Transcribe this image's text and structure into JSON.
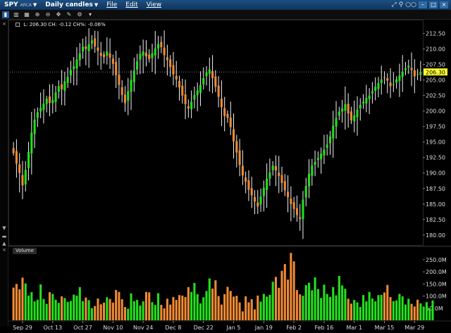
{
  "titlebar": {
    "symbol": "SPY",
    "exchange": "ARCA",
    "chart_type": "Daily candles",
    "menus": [
      "File",
      "Edit",
      "View"
    ]
  },
  "infobar": {
    "text": "L: 206.30 CH: -0.12 CH%: -0.06%"
  },
  "volume_label": "Volume",
  "last_price": "206.30",
  "colors": {
    "up": "#22e01c",
    "down": "#f08a35",
    "background": "#000000",
    "last_tag": "#ffff33"
  },
  "chart_data": [
    {
      "type": "candlestick",
      "price_ticks": [
        "212.50",
        "210.00",
        "207.50",
        "205.00",
        "202.50",
        "200.00",
        "197.50",
        "195.00",
        "192.50",
        "190.00",
        "187.50",
        "185.00",
        "182.50",
        "180.00"
      ],
      "x_tick_labels": [
        "Sep 29",
        "Oct 13",
        "Oct 27",
        "Nov 10",
        "Nov 24",
        "Dec 8",
        "Dec 22",
        "Jan 5",
        "Jan 19",
        "Feb 2",
        "Feb 16",
        "Mar 1",
        "Mar 15",
        "Mar 29"
      ],
      "ylim": [
        178.5,
        214.5
      ],
      "closes": [
        193.2,
        191.5,
        190.0,
        188.0,
        190.5,
        193.4,
        196.5,
        198.6,
        199.8,
        200.5,
        201.2,
        202.0,
        201.3,
        201.8,
        203.0,
        204.0,
        203.5,
        204.8,
        205.5,
        206.6,
        207.2,
        208.3,
        209.3,
        210.4,
        210.0,
        210.8,
        211.4,
        210.4,
        209.7,
        208.9,
        208.7,
        209.6,
        208.6,
        207.6,
        205.8,
        204.2,
        202.6,
        201.3,
        203.2,
        205.0,
        206.5,
        208.0,
        209.2,
        209.6,
        208.8,
        208.4,
        209.3,
        210.1,
        210.8,
        210.3,
        209.0,
        208.2,
        207.1,
        205.9,
        205.1,
        203.8,
        202.5,
        201.1,
        200.4,
        201.5,
        202.6,
        203.3,
        204.2,
        205.3,
        206.2,
        206.7,
        205.3,
        203.9,
        202.3,
        200.6,
        199.2,
        198.9,
        197.4,
        195.1,
        193.3,
        191.3,
        189.6,
        188.6,
        187.3,
        186.4,
        185.4,
        184.6,
        186.2,
        187.6,
        189.1,
        190.1,
        191.2,
        190.4,
        189.5,
        188.4,
        187.2,
        186.1,
        185.0,
        184.2,
        183.2,
        182.6,
        185.7,
        187.9,
        189.9,
        191.2,
        191.8,
        192.4,
        193.1,
        193.8,
        194.6,
        195.9,
        197.6,
        198.9,
        199.9,
        200.4,
        201.1,
        199.6,
        198.5,
        199.3,
        200.2,
        201.0,
        201.5,
        202.1,
        202.5,
        203.2,
        203.9,
        204.5,
        205.1,
        205.4,
        204.9,
        204.0,
        204.3,
        205.1,
        205.7,
        206.3,
        206.9,
        207.3,
        206.6,
        205.6,
        205.9,
        206.3
      ]
    },
    {
      "type": "bar",
      "name": "Volume",
      "ticks": [
        "250.0M",
        "200.0M",
        "150.0M",
        "100.0M",
        "50.0M"
      ],
      "ylim": [
        0,
        270000000
      ],
      "values": [
        135000000,
        150000000,
        128000000,
        176000000,
        152000000,
        102000000,
        116000000,
        78000000,
        85000000,
        148000000,
        88000000,
        68000000,
        116000000,
        109000000,
        85000000,
        72000000,
        99000000,
        92000000,
        76000000,
        80000000,
        106000000,
        102000000,
        137000000,
        79000000,
        94000000,
        83000000,
        50000000,
        59000000,
        90000000,
        66000000,
        73000000,
        95000000,
        88000000,
        73000000,
        125000000,
        117000000,
        87000000,
        55000000,
        48000000,
        111000000,
        79000000,
        84000000,
        61000000,
        78000000,
        117000000,
        115000000,
        75000000,
        63000000,
        112000000,
        64000000,
        49000000,
        89000000,
        65000000,
        96000000,
        84000000,
        104000000,
        102000000,
        96000000,
        137000000,
        117000000,
        154000000,
        108000000,
        70000000,
        95000000,
        121000000,
        173000000,
        131000000,
        165000000,
        100000000,
        65000000,
        108000000,
        138000000,
        121000000,
        98000000,
        101000000,
        74000000,
        37000000,
        99000000,
        74000000,
        87000000,
        45000000,
        102000000,
        77000000,
        109000000,
        98000000,
        105000000,
        159000000,
        179000000,
        134000000,
        204000000,
        232000000,
        168000000,
        278000000,
        243000000,
        125000000,
        107000000,
        101000000,
        145000000,
        155000000,
        124000000,
        177000000,
        129000000,
        92000000,
        147000000,
        109000000,
        97000000,
        137000000,
        103000000,
        183000000,
        144000000,
        130000000,
        89000000,
        69000000,
        84000000,
        74000000,
        55000000,
        104000000,
        78000000,
        117000000,
        90000000,
        78000000,
        104000000,
        105000000,
        115000000,
        146000000,
        96000000,
        79000000,
        82000000,
        109000000,
        99000000,
        65000000,
        89000000,
        68000000,
        57000000,
        85000000,
        70000000,
        57000000,
        75000000,
        50000000,
        82000000
      ]
    }
  ]
}
